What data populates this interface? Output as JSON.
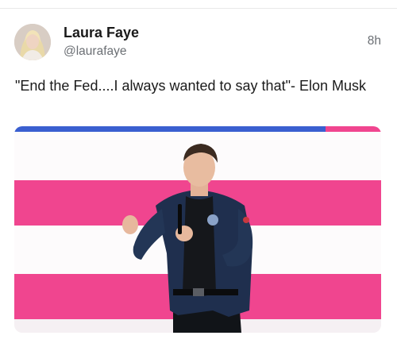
{
  "tweet": {
    "author_name": "Laura Faye",
    "author_handle": "@laurafaye",
    "timestamp": "8h",
    "text": "\"End the Fed....I always wanted to say that\"- Elon Musk"
  },
  "icons": {
    "avatar": "profile-photo",
    "media": "speaker-on-stage-photo"
  },
  "colors": {
    "stage_pink": "#f0458f",
    "stage_blue": "#3a5fd0",
    "jacket_navy": "#1f2f4e",
    "muted_text": "#6b6f74"
  }
}
